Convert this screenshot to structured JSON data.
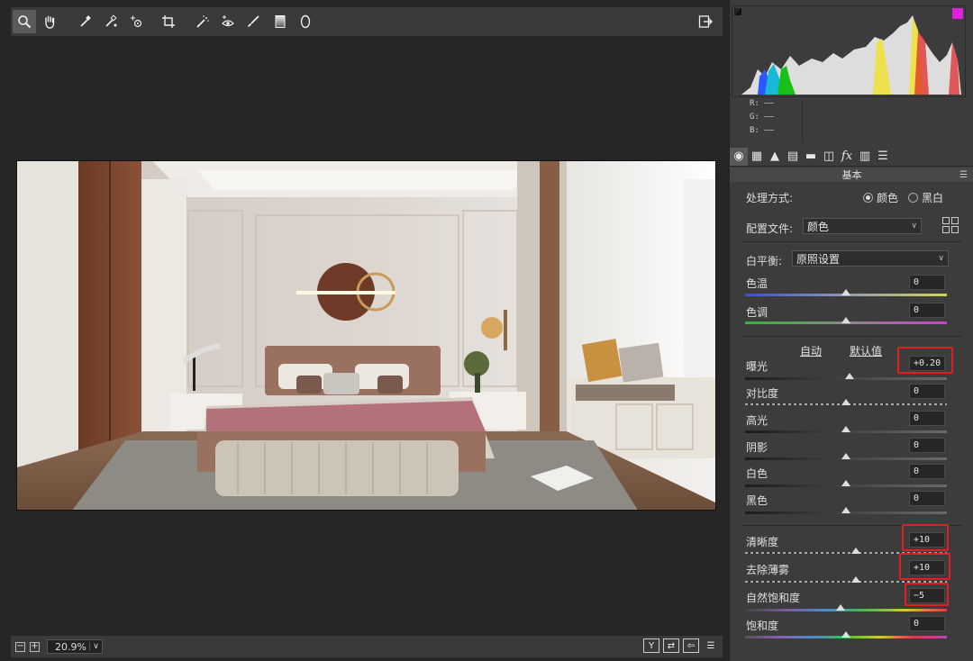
{
  "toolbar": {
    "tools": [
      "zoom-icon",
      "hand-icon",
      "white-balance-icon",
      "color-sampler-icon",
      "target-adjust-icon",
      "crop-icon",
      "spot-removal-icon",
      "red-eye-icon",
      "brush-icon",
      "graduated-filter-icon",
      "radial-filter-icon"
    ],
    "exit": "open-preferences-icon"
  },
  "bottom": {
    "zoom_out": "−",
    "zoom_in": "+",
    "zoom_value": "20.9%",
    "btn_y": "Y",
    "btn_swap": "⇄",
    "btn_copy": "⇦",
    "btn_settings": "☰"
  },
  "histogram": {
    "r_label": "R:",
    "g_label": "G:",
    "b_label": "B:",
    "r_value": "——",
    "g_value": "——",
    "b_value": "——"
  },
  "panel": {
    "section_title": "基本",
    "treatment_label": "处理方式:",
    "treatment_color": "颜色",
    "treatment_bw": "黑白",
    "profile_label": "配置文件:",
    "profile_value": "颜色",
    "wb_label": "白平衡:",
    "wb_value": "原照设置",
    "auto": "自动",
    "default": "默认值"
  },
  "sliders": {
    "temp": {
      "label": "色温",
      "value": "0",
      "level": 0.5
    },
    "tint": {
      "label": "色调",
      "value": "0",
      "level": 0.5
    },
    "exposure": {
      "label": "曝光",
      "value": "+0.20",
      "level": 0.52
    },
    "contrast": {
      "label": "对比度",
      "value": "0",
      "level": 0.5
    },
    "highlights": {
      "label": "高光",
      "value": "0",
      "level": 0.5
    },
    "shadows": {
      "label": "阴影",
      "value": "0",
      "level": 0.5
    },
    "whites": {
      "label": "白色",
      "value": "0",
      "level": 0.5
    },
    "blacks": {
      "label": "黑色",
      "value": "0",
      "level": 0.5
    },
    "clarity": {
      "label": "清晰度",
      "value": "+10",
      "level": 0.55
    },
    "dehaze": {
      "label": "去除薄雾",
      "value": "+10",
      "level": 0.55
    },
    "vibrance": {
      "label": "自然饱和度",
      "value": "−5",
      "level": 0.475
    },
    "saturation": {
      "label": "饱和度",
      "value": "0",
      "level": 0.5
    }
  },
  "colors": {
    "highlight_box": "#e02020",
    "panel_bg": "#3c3c3c",
    "canvas_bg": "#262626"
  }
}
